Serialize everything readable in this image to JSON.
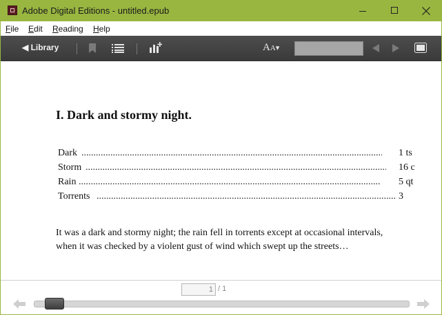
{
  "window": {
    "title": "Adobe Digital Editions - untitled.epub"
  },
  "menu": {
    "file": {
      "underlined": "F",
      "rest": "ile"
    },
    "edit": {
      "underlined": "E",
      "rest": "dit"
    },
    "reading": {
      "underlined": "R",
      "rest": "eading"
    },
    "help": {
      "underlined": "H",
      "rest": "elp"
    }
  },
  "toolbar": {
    "library_label": "◀ Library",
    "font_size_big": "A",
    "font_size_small": "A",
    "search_value": ""
  },
  "book": {
    "chapter_title": "I. Dark and stormy night.",
    "toc": [
      {
        "label": "Dark",
        "value": "1 ts"
      },
      {
        "label": "Storm",
        "value": "16 c"
      },
      {
        "label": "Rain",
        "value": "5 qt"
      },
      {
        "label": "Torrents",
        "value": "3"
      }
    ],
    "paragraph": "It was a dark and stormy night; the rain fell in torrents except at occasional intervals, when it was checked by a violent gust of wind which swept up the streets…"
  },
  "navigation": {
    "current_page": "1",
    "total_pages": "/ 1",
    "progress": 0.02
  },
  "colors": {
    "titlebar": "#99b640",
    "toolbar": "#444444"
  }
}
